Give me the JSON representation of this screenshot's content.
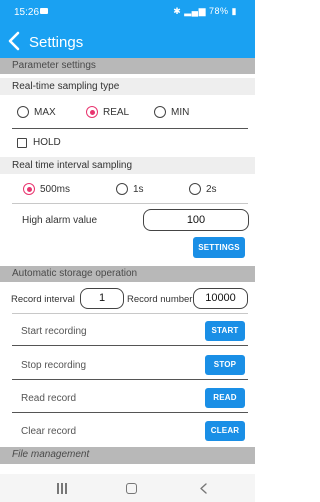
{
  "status_bar": {
    "time": "15:26",
    "battery": "78%"
  },
  "app_bar": {
    "title": "Settings"
  },
  "parameter_settings": {
    "header": "Parameter settings",
    "sampling_type": {
      "label": "Real-time sampling type",
      "options": [
        "MAX",
        "REAL",
        "MIN"
      ],
      "selected": "REAL"
    },
    "hold": {
      "label": "HOLD",
      "checked": false
    },
    "interval_sampling": {
      "label": "Real time interval sampling",
      "options": [
        "500ms",
        "1s",
        "2s"
      ],
      "selected": "500ms"
    },
    "high_alarm": {
      "label": "High alarm value",
      "value": "100"
    },
    "settings_button": "SETTINGS"
  },
  "storage": {
    "header": "Automatic storage operation",
    "record_interval": {
      "label": "Record interval",
      "value": "1"
    },
    "record_number": {
      "label": "Record number",
      "value": "10000"
    },
    "actions": [
      {
        "label": "Start recording",
        "button": "START"
      },
      {
        "label": "Stop recording",
        "button": "STOP"
      },
      {
        "label": "Read record",
        "button": "READ"
      },
      {
        "label": "Clear record",
        "button": "CLEAR"
      }
    ]
  },
  "file_management": {
    "header": "File management"
  },
  "colors": {
    "accent": "#1aa1f2",
    "button": "#1a8fe6",
    "radio_selected": "#e8356f",
    "section_header": "#b8b8b8"
  }
}
